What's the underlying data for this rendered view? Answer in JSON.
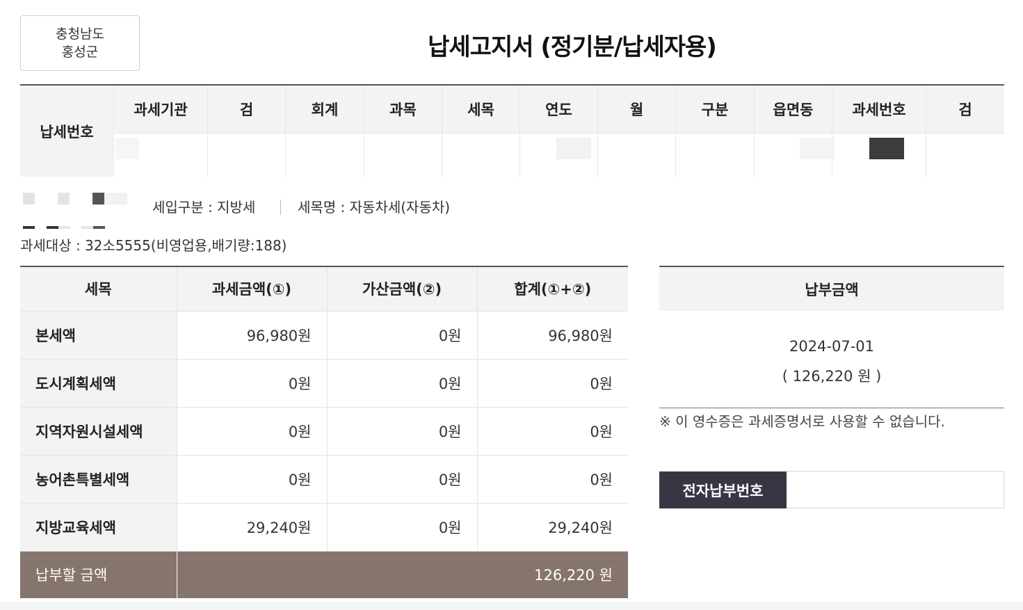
{
  "region": {
    "line1": "충청남도",
    "line2": "홍성군"
  },
  "title": "납세고지서 (정기분/납세자용)",
  "tax_number": {
    "label": "납세번호",
    "columns": [
      "과세기관",
      "검",
      "회계",
      "과목",
      "세목",
      "연도",
      "월",
      "구분",
      "읍면동",
      "과세번호",
      "검"
    ]
  },
  "info": {
    "revenue_type": "세입구분 : 지방세",
    "tax_item_name": "세목명 : 자동차세(자동차)",
    "target": "과세대상 : 32소5555(비영업용,배기량:188)"
  },
  "amounts": {
    "headers": [
      "세목",
      "과세금액(①)",
      "가산금액(②)",
      "합계(①+②)"
    ],
    "rows": [
      {
        "item": "본세액",
        "tax": "96,980원",
        "penalty": "0원",
        "total": "96,980원"
      },
      {
        "item": "도시계획세액",
        "tax": "0원",
        "penalty": "0원",
        "total": "0원"
      },
      {
        "item": "지역자원시설세액",
        "tax": "0원",
        "penalty": "0원",
        "total": "0원"
      },
      {
        "item": "농어촌특별세액",
        "tax": "0원",
        "penalty": "0원",
        "total": "0원"
      },
      {
        "item": "지방교육세액",
        "tax": "29,240원",
        "penalty": "0원",
        "total": "29,240원"
      }
    ],
    "total_label": "납부할 금액",
    "total_value": "126,220 원"
  },
  "payment": {
    "header": "납부금액",
    "date": "2024-07-01",
    "amount": "( 126,220 원 )"
  },
  "notice": "※ 이 영수증은 과세증명서로 사용할 수 없습니다.",
  "epay": {
    "label": "전자납부번호",
    "value": ""
  }
}
